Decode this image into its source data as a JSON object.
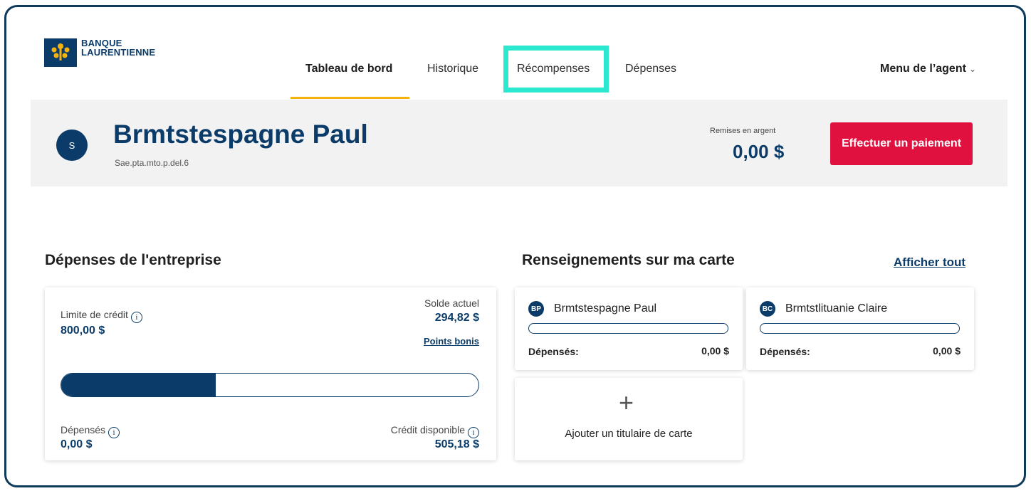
{
  "brand": {
    "line1": "BANQUE",
    "line2": "LAURENTIENNE",
    "logo_icon": "maple-leaf-logo"
  },
  "nav": {
    "items": [
      {
        "label": "Tableau de bord",
        "active": true
      },
      {
        "label": "Historique"
      },
      {
        "label": "Récompenses",
        "highlighted": true
      },
      {
        "label": "Dépenses"
      }
    ],
    "agent_menu": "Menu de l’agent"
  },
  "account": {
    "avatar_initial": "S",
    "name": "Brmtstespagne Paul",
    "id": "Sae.pta.mto.p.del.6",
    "cash_back_label": "Remises en argent",
    "cash_back_value": "0,00 $",
    "pay_button": "Effectuer un paiement"
  },
  "spend": {
    "title": "Dépenses de l'entreprise",
    "credit_limit_label": "Limite de crédit",
    "credit_limit_value": "800,00 $",
    "balance_label": "Solde actuel",
    "balance_value": "294,82 $",
    "points_link": "Points bonis",
    "utilization_fraction": 0.37,
    "spent_label": "Dépensés",
    "spent_value": "0,00 $",
    "available_label": "Crédit disponible",
    "available_value": "505,18 $"
  },
  "cards": {
    "title": "Renseignements sur ma carte",
    "show_all": "Afficher tout",
    "items": [
      {
        "initials": "BP",
        "holder": "Brmtstespagne Paul",
        "spent_label": "Dépensés:",
        "spent_value": "0,00 $"
      },
      {
        "initials": "BC",
        "holder": "Brmtstlituanie Claire",
        "spent_label": "Dépensés:",
        "spent_value": "0,00 $"
      }
    ],
    "add_label": "Ajouter un titulaire de carte"
  },
  "colors": {
    "brand_navy": "#0b3b68",
    "accent_yellow": "#f5b30f",
    "primary_red": "#e0113f",
    "highlight_teal": "#2ce8cf"
  }
}
